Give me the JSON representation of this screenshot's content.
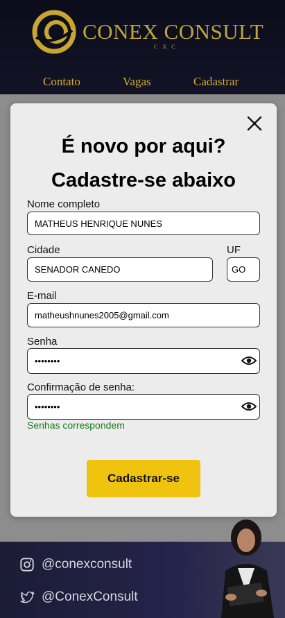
{
  "header": {
    "brand": "CONEX CONSULT",
    "brand_sub": "CXC",
    "nav": [
      {
        "label": "Contato"
      },
      {
        "label": "Vagas"
      },
      {
        "label": "Cadastrar"
      }
    ]
  },
  "modal": {
    "title_line1": "É novo por aqui?",
    "title_line2": "Cadastre-se abaixo",
    "fields": {
      "name": {
        "label": "Nome completo",
        "value": "MATHEUS HENRIQUE NUNES"
      },
      "city": {
        "label": "Cidade",
        "value": "SENADOR CANEDO"
      },
      "uf": {
        "label": "UF",
        "value": "GO"
      },
      "email": {
        "label": "E-mail",
        "value": "matheushnunes2005@gmail.com"
      },
      "password": {
        "label": "Senha",
        "value": "••••••••"
      },
      "confirm": {
        "label": "Confirmação de senha:",
        "value": "••••••••"
      }
    },
    "match_message": "Senhas correspondem",
    "submit_label": "Cadastrar-se"
  },
  "footer": {
    "instagram": "@conexconsult",
    "twitter": "@ConexConsult"
  },
  "colors": {
    "accent": "#f0c40e",
    "brand_gold": "#bfa53a",
    "success": "#1e7a1e",
    "header_bg": "#0b0c1a"
  },
  "icons": [
    "logo-icon",
    "close-icon",
    "eye-icon",
    "instagram-icon",
    "twitter-icon"
  ]
}
